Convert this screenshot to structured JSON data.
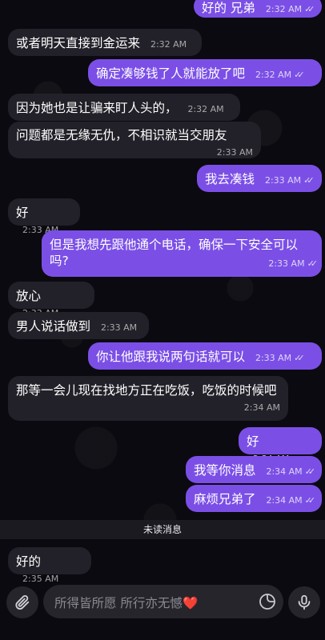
{
  "messages": [
    {
      "side": "out",
      "text": "好的 兄弟",
      "time": "2:32 AM",
      "read": true
    },
    {
      "side": "in",
      "text": "或者明天直接到金运来",
      "time": "2:32 AM"
    },
    {
      "side": "out",
      "text": "确定凑够钱了人就能放了吧",
      "time": "2:32 AM",
      "read": true
    },
    {
      "side": "in",
      "text": "因为她也是让骗来盯人头的，",
      "time": "2:32 AM"
    },
    {
      "side": "in",
      "text": "问题都是无缘无仇，不相识就当交朋友",
      "time": "2:33 AM"
    },
    {
      "side": "out",
      "text": "我去凑钱",
      "time": "2:33 AM",
      "read": true
    },
    {
      "side": "in",
      "text": "好",
      "time": "2:33 AM"
    },
    {
      "side": "out",
      "text": "但是我想先跟他通个电话，确保一下安全可以吗?",
      "time": "2:33 AM",
      "read": true
    },
    {
      "side": "in",
      "text": "放心",
      "time": "2:33 AM"
    },
    {
      "side": "in",
      "text": "男人说话做到",
      "time": "2:33 AM"
    },
    {
      "side": "out",
      "text": "你让他跟我说两句话就可以",
      "time": "2:33 AM",
      "read": true
    },
    {
      "side": "in",
      "text": "那等一会儿现在找地方正在吃饭，吃饭的时候吧",
      "time": "2:34 AM"
    },
    {
      "side": "out",
      "text": "好",
      "time": "2:34 AM",
      "read": true
    },
    {
      "side": "out",
      "text": "我等你消息",
      "time": "2:34 AM",
      "read": true
    },
    {
      "side": "out",
      "text": "麻烦兄弟了",
      "time": "2:34 AM",
      "read": true
    },
    {
      "side": "in",
      "text": "好的",
      "time": "2:35 AM"
    }
  ],
  "unread_label": "未读消息",
  "composer": {
    "placeholder_prefix": "所得皆所愿 所行亦无憾",
    "heart": "❤️"
  },
  "icons": {
    "attach": "paperclip-icon",
    "sticker": "sticker-icon",
    "mic": "microphone-icon",
    "read": "double-check-icon"
  },
  "colors": {
    "outgoing": "#7b4fe6",
    "incoming": "#222129",
    "background": "#0b0a10"
  }
}
